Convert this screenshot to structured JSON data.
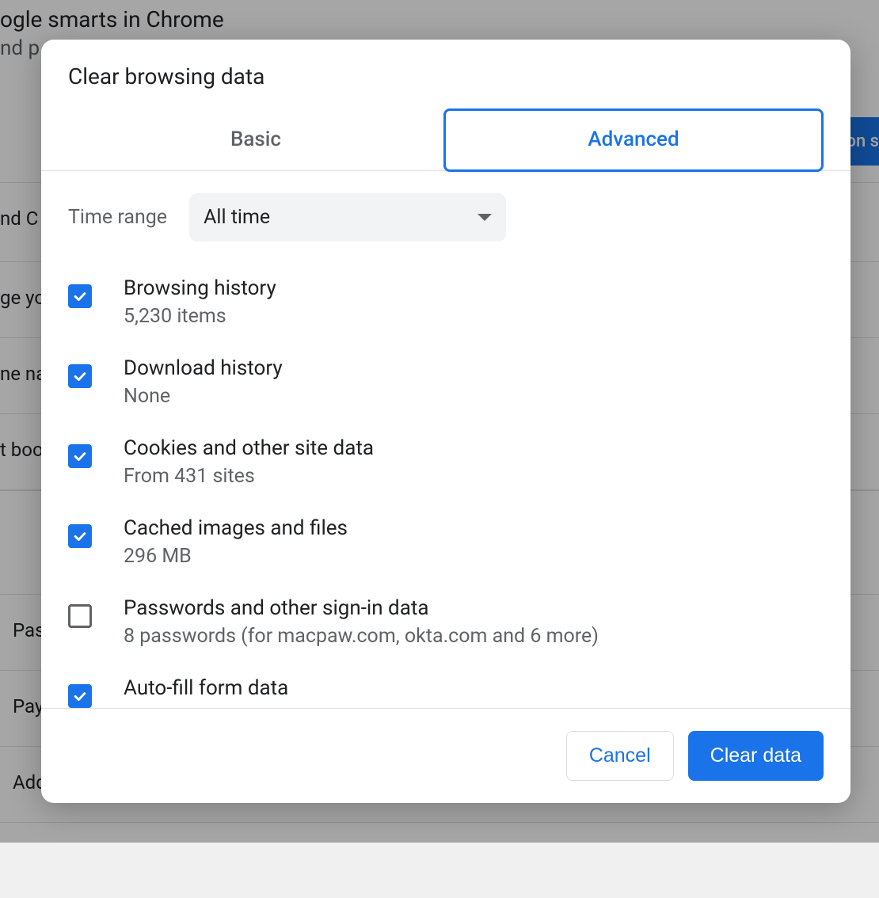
{
  "background": {
    "headline": "ogle smarts in Chrome",
    "sub": "nd p",
    "row_texts": [
      "nd C",
      "ge yo",
      "ne na",
      "t boo",
      "Pass",
      "Payr",
      "Add"
    ],
    "blue_btn_fragment": "on s"
  },
  "dialog": {
    "title": "Clear browsing data",
    "tabs": {
      "basic": "Basic",
      "advanced": "Advanced"
    },
    "time_range": {
      "label": "Time range",
      "value": "All time"
    },
    "options": [
      {
        "checked": true,
        "title": "Browsing history",
        "sub": "5,230 items"
      },
      {
        "checked": true,
        "title": "Download history",
        "sub": "None"
      },
      {
        "checked": true,
        "title": "Cookies and other site data",
        "sub": "From 431 sites"
      },
      {
        "checked": true,
        "title": "Cached images and files",
        "sub": "296 MB"
      },
      {
        "checked": false,
        "title": "Passwords and other sign-in data",
        "sub": "8 passwords (for macpaw.com, okta.com and 6 more)"
      },
      {
        "checked": true,
        "title": "Auto-fill form data",
        "sub": ""
      }
    ],
    "buttons": {
      "cancel": "Cancel",
      "clear": "Clear data"
    }
  }
}
